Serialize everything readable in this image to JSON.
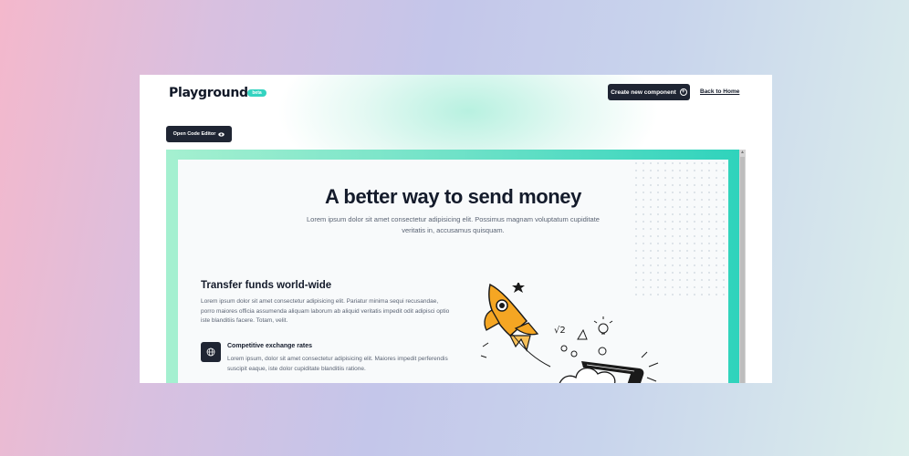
{
  "header": {
    "brand": "Playground",
    "badge": "beta",
    "create_button": "Create new component",
    "back_link": "Back to Home"
  },
  "toolbar": {
    "code_editor_button": "Open Code Editor"
  },
  "preview": {
    "hero_title": "A better way to send money",
    "hero_subtitle": "Lorem ipsum dolor sit amet consectetur adipisicing elit. Possimus magnam voluptatum cupiditate veritatis in, accusamus quisquam.",
    "section_title": "Transfer funds world-wide",
    "section_text": "Lorem ipsum dolor sit amet consectetur adipisicing elit. Pariatur minima sequi recusandae, porro maiores officia assumenda aliquam laborum ab aliquid veritatis impedit odit adipisci optio iste blanditiis facere. Totam, velit.",
    "feature_title": "Competitive exchange rates",
    "feature_text": "Lorem ipsum, dolor sit amet consectetur adipisicing elit. Maiores impedit perferendis suscipit eaque, iste dolor cupiditate blanditiis ratione.",
    "feature_icon": "globe-icon",
    "illustration": "rocket-launch-illustration",
    "sqrt_label": "√2"
  },
  "colors": {
    "accent": "#34d3c0",
    "dark_button": "#1f2533",
    "rocket_orange": "#f5a623"
  }
}
